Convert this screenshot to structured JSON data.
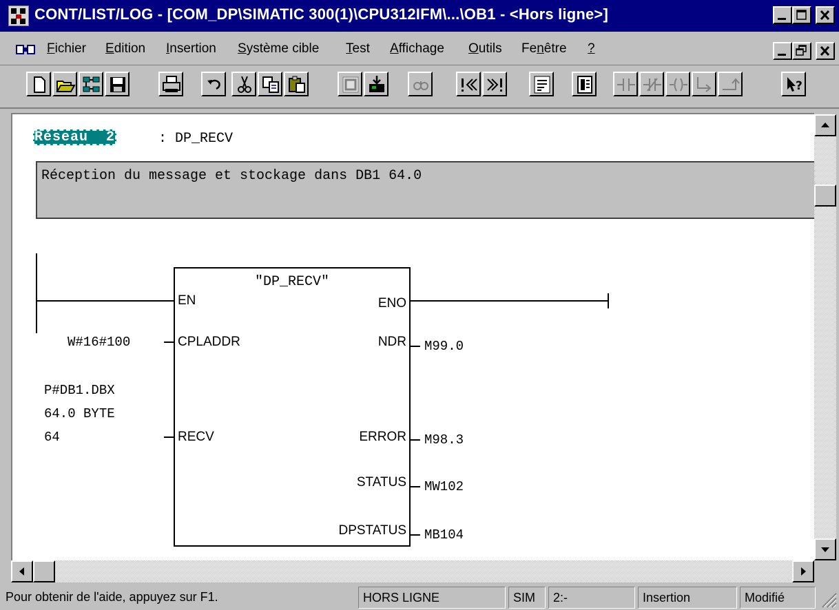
{
  "window": {
    "title": "CONT/LIST/LOG - [COM_DP\\SIMATIC 300(1)\\CPU312IFM\\...\\OB1 - <Hors ligne>]",
    "title_bar_color": "#000080"
  },
  "menu": {
    "items": [
      {
        "key": "F",
        "rest": "ichier"
      },
      {
        "key": "E",
        "rest": "dition"
      },
      {
        "key": "I",
        "rest": "nsertion"
      },
      {
        "key": "S",
        "rest": "ystème cible"
      },
      {
        "key": "T",
        "rest": "est"
      },
      {
        "key": "A",
        "rest": "ffichage"
      },
      {
        "key": "O",
        "rest": "utils"
      },
      {
        "pre": "Fe",
        "key": "n",
        "rest": "être"
      },
      {
        "key": "?",
        "rest": ""
      }
    ]
  },
  "toolbar": {
    "buttons": [
      "new-icon",
      "open-icon",
      "network-icon",
      "save-icon",
      "print-icon",
      "undo-icon",
      "cut-icon",
      "copy-icon",
      "paste-icon",
      "compile-icon",
      "download-icon",
      "monitor-icon",
      "previous-network-icon",
      "next-network-icon",
      "overview-icon",
      "program-elements-icon",
      "normally-open-contact-icon",
      "normally-closed-contact-icon",
      "coil-icon",
      "branch-open-icon",
      "branch-close-icon",
      "context-help-icon"
    ]
  },
  "network": {
    "label": "Réseau  2",
    "title": ": DP_RECV",
    "comment": "Réception du message et stockage dans DB1 64.0",
    "label_color": "#008080"
  },
  "block": {
    "name": "\"DP_RECV\"",
    "inputs": {
      "en": "EN",
      "cpladdr": "CPLADDR",
      "recv": "RECV"
    },
    "outputs": {
      "eno": "ENO",
      "ndr": "NDR",
      "error": "ERROR",
      "status": "STATUS",
      "dpstatus": "DPSTATUS"
    },
    "operands": {
      "cpladdr": "W#16#100",
      "recv_1": "P#DB1.DBX",
      "recv_2": "64.0 BYTE",
      "recv_3": "64",
      "ndr": "M99.0",
      "error": "M98.3",
      "status": "MW102",
      "dpstatus": "MB104"
    }
  },
  "status": {
    "help": "Pour obtenir de l'aide, appuyez sur F1.",
    "mode": "HORS LIGNE",
    "sim": "SIM",
    "position": "2:-",
    "insert": "Insertion",
    "modified": "Modifié"
  }
}
